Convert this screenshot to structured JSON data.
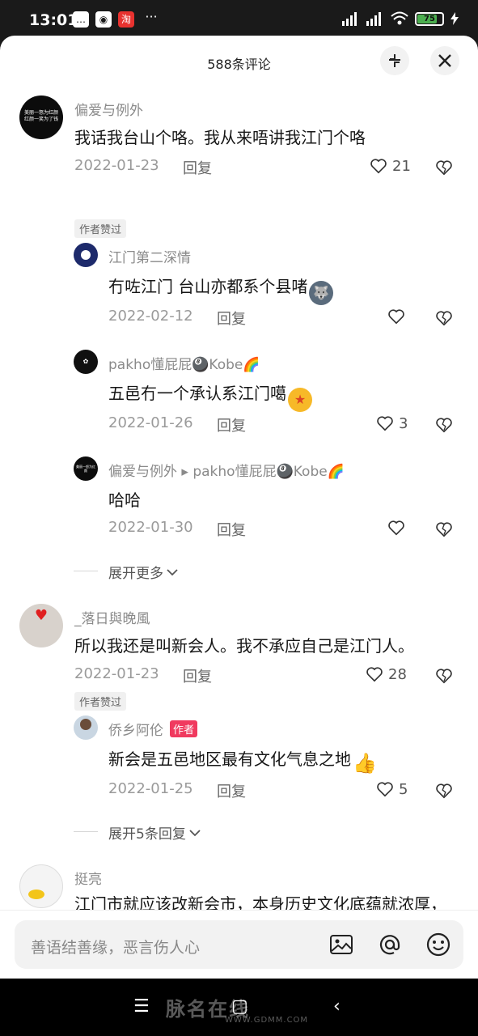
{
  "status": {
    "time": "13:01",
    "battery": "75"
  },
  "header": {
    "title": "588条评论"
  },
  "comments": [
    {
      "name": "偏爱与例外",
      "text": "我话我台山个咯。我从来唔讲我江门个咯",
      "date": "2022-01-23",
      "reply": "回复",
      "likes": "21",
      "badge": "作者赞过",
      "replies": [
        {
          "name": "江门第二深情",
          "text": "冇咗江门 台山亦都系个县啫",
          "date": "2022-02-12",
          "reply": "回复",
          "likes": ""
        },
        {
          "name": "pakho懂屁屁🎱Kobe🌈",
          "text": "五邑冇一个承认系江门噶",
          "date": "2022-01-26",
          "reply": "回复",
          "likes": "3"
        },
        {
          "name": "偏爱与例外 ▸ pakho懂屁屁🎱Kobe🌈",
          "text": "哈哈",
          "date": "2022-01-30",
          "reply": "回复",
          "likes": ""
        }
      ],
      "expand": "展开更多"
    },
    {
      "name": "_落日與晚風",
      "text": "所以我还是叫新会人。我不承应自己是江门人。",
      "date": "2022-01-23",
      "reply": "回复",
      "likes": "28",
      "badge": "作者赞过",
      "replies": [
        {
          "name": "侨乡阿伦",
          "tag": "作者",
          "text": "新会是五邑地区最有文化气息之地",
          "date": "2022-01-25",
          "reply": "回复",
          "likes": "5"
        }
      ],
      "expand": "展开5条回复"
    },
    {
      "name": "挺亮",
      "text": "江门市就应该改新会市，本身历史文化底蕴就浓厚，蓬江区，江海区保留，新会区改回古名冈州"
    }
  ],
  "input": {
    "placeholder": "善语结善缘，恶言伤人心"
  },
  "watermark": {
    "main": "脉名在线",
    "sub": "WWW.GDMM.COM"
  },
  "colors": {
    "author_tag": "#f03a5f",
    "text": "#161616",
    "meta": "#9a9a9a"
  }
}
